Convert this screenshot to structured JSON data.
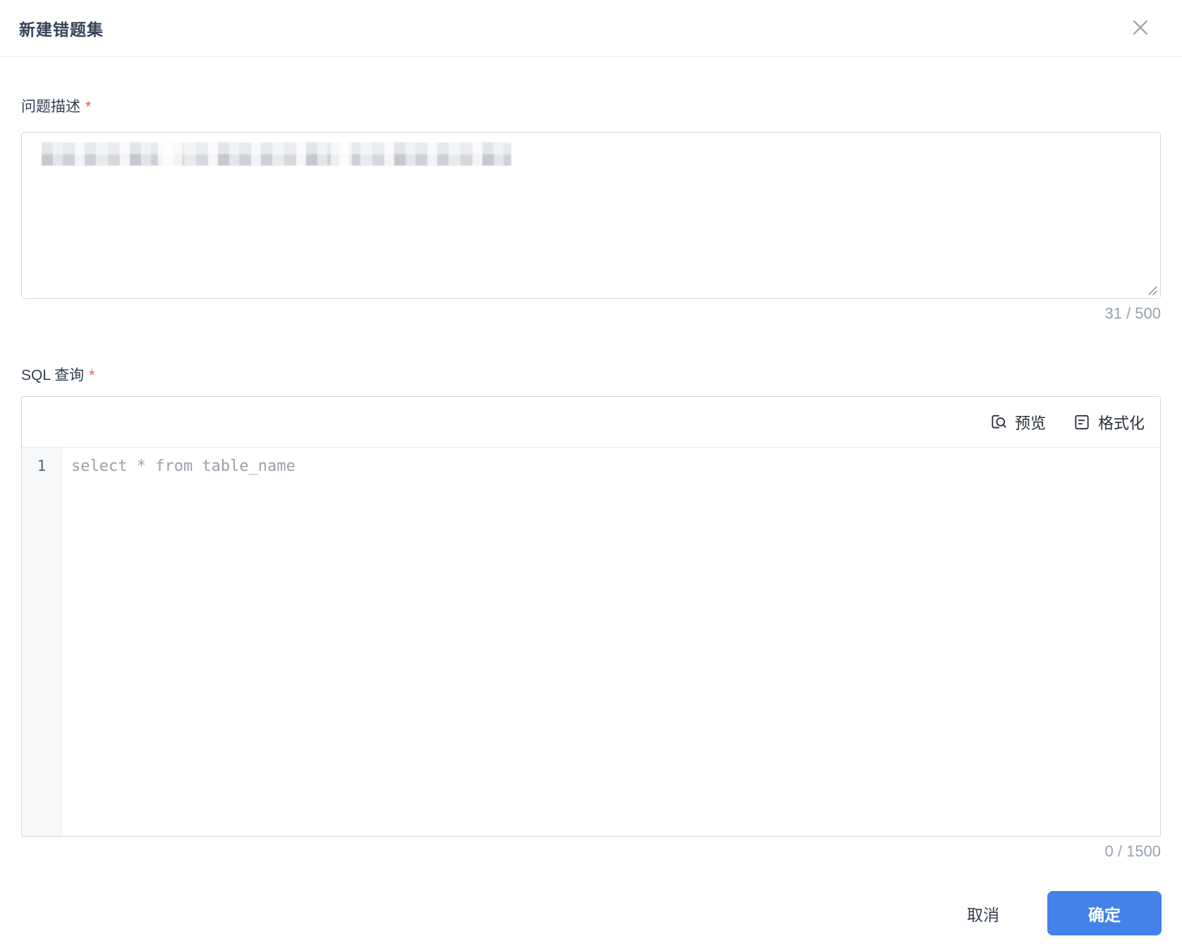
{
  "dialog": {
    "title": "新建错题集"
  },
  "form": {
    "description": {
      "label": "问题描述",
      "required_mark": "*",
      "value_state": "redacted",
      "char_count": "31 / 500"
    },
    "sql": {
      "label": "SQL 查询",
      "required_mark": "*",
      "toolbar": {
        "preview_label": "预览",
        "format_label": "格式化"
      },
      "editor": {
        "line_number": "1",
        "placeholder": "select * from table_name"
      },
      "char_count": "0 / 1500"
    }
  },
  "footer": {
    "cancel_label": "取消",
    "confirm_label": "确定"
  },
  "colors": {
    "accent_blue": "#4382e9",
    "required_red": "#f2544a",
    "label_text": "#333e50",
    "muted_text": "#98a1ae",
    "border": "#d4d7dd"
  }
}
